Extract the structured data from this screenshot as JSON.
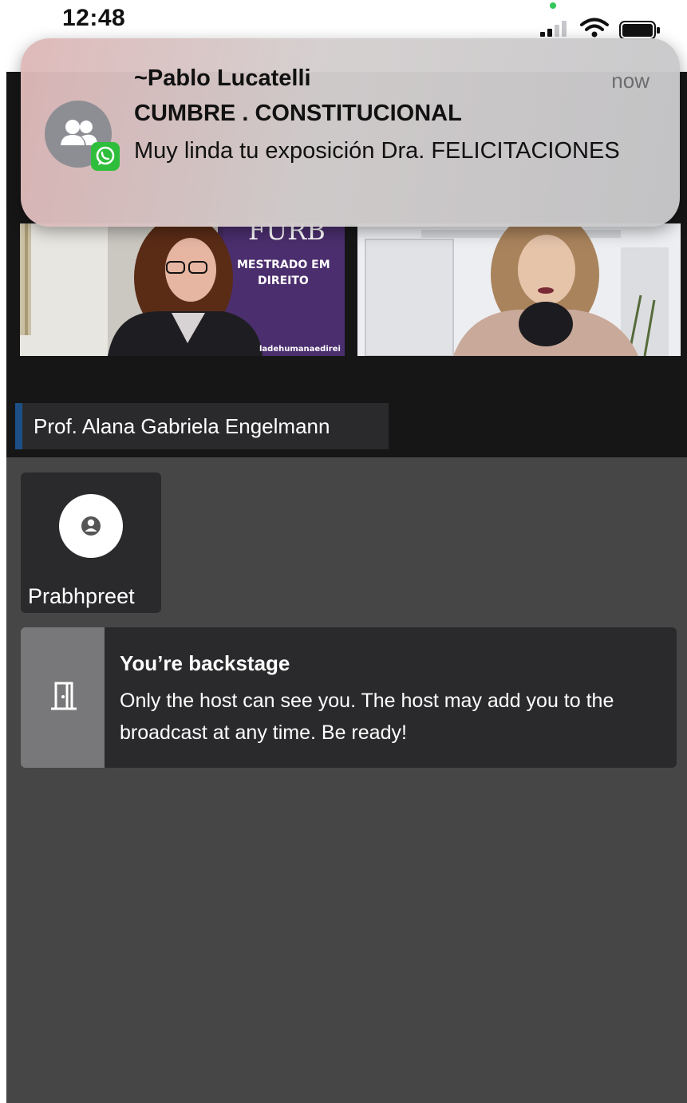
{
  "status_bar": {
    "time": "12:48",
    "icons": [
      "privacy-dot",
      "signal-icon",
      "wifi-icon",
      "battery-icon"
    ]
  },
  "notification": {
    "app_icon": "group-icon",
    "badge_icon": "whatsapp-icon",
    "sender": "~Pablo Lucatelli",
    "time": "now",
    "group": "CUMBRE . CONSTITUCIONAL",
    "message": "Muy linda tu exposición Dra. FELICITACIONES"
  },
  "stage": {
    "video_left_text": {
      "logo": "FURB",
      "line1": "MESTRADO EM",
      "line2": "DIREITO",
      "handle": "ladehumanaedirei"
    },
    "speaker_name": "Prof. Alana Gabriela Engelmann"
  },
  "participant": {
    "avatar_icon": "user-icon",
    "name": "Prabhpreet"
  },
  "backstage": {
    "icon": "door-icon",
    "title": "You’re backstage",
    "text": "Only the host can see you. The host may add you to the broadcast at any time. Be ready!"
  },
  "colors": {
    "app_background": "#464647",
    "stage_background": "#161617",
    "card_background": "#2a2a2c",
    "name_accent": "#1c4f86",
    "icon_box": "#78787a"
  }
}
